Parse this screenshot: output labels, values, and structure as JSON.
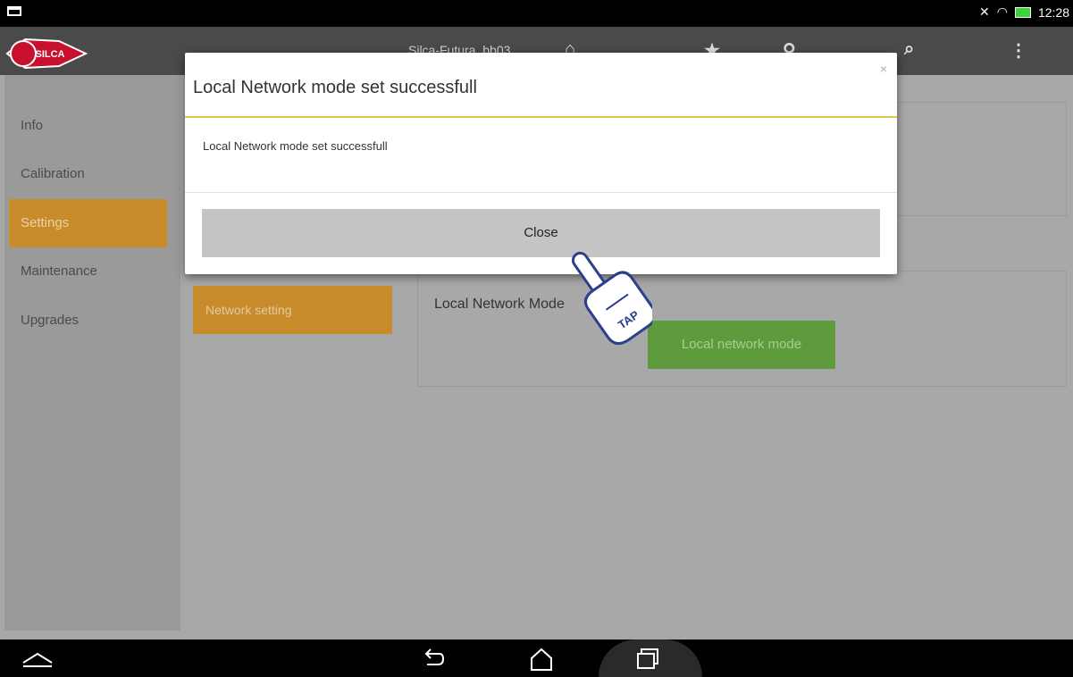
{
  "status": {
    "time": "12:28"
  },
  "appbar": {
    "title": "Silca-Futura_bb03",
    "logo_text": "SILCA"
  },
  "sidebar": {
    "items": [
      {
        "label": "Info"
      },
      {
        "label": "Calibration"
      },
      {
        "label": "Settings"
      },
      {
        "label": "Maintenance"
      },
      {
        "label": "Upgrades"
      }
    ]
  },
  "main": {
    "network_setting_label": "Network setting",
    "local_network_mode_label": "Local Network Mode",
    "local_network_mode_button": "Local network mode"
  },
  "modal": {
    "title": "Local Network mode set successfull",
    "close_x": "×",
    "message": "Local Network mode set successfull",
    "close_label": "Close"
  },
  "tap_hint": {
    "label": "TAP"
  },
  "colors": {
    "accent": "#c88d2a",
    "green": "#5e9b3c",
    "modal_rule": "#e6c64a"
  }
}
